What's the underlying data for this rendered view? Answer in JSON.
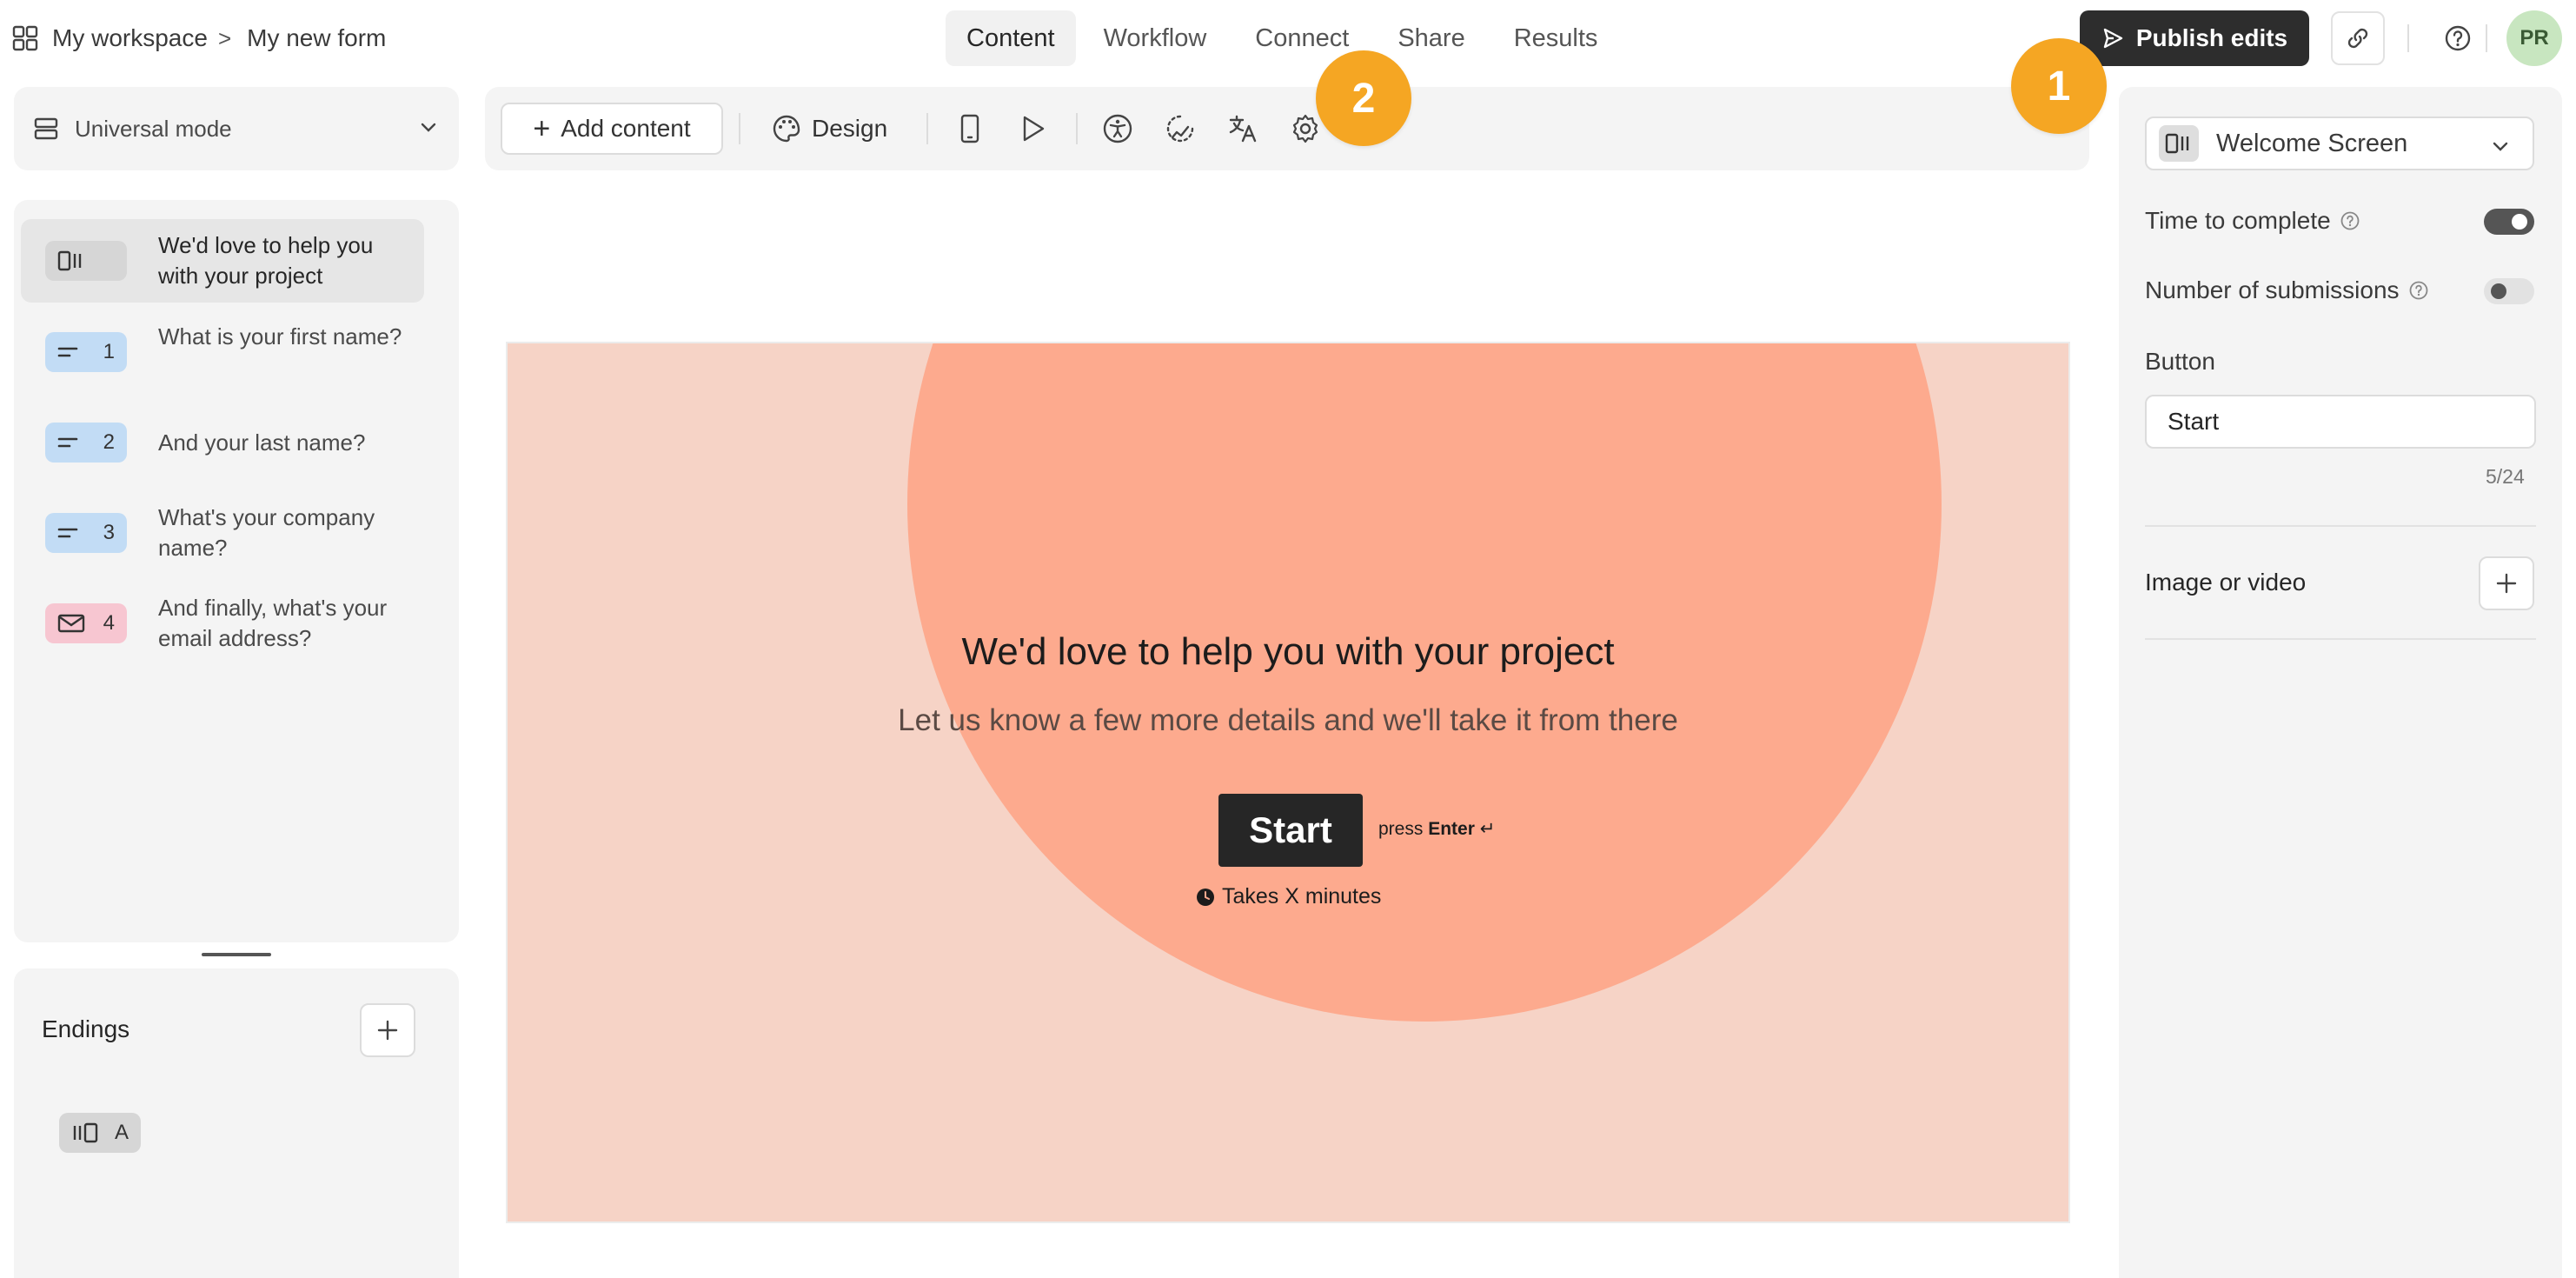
{
  "breadcrumb": {
    "workspace": "My workspace",
    "separator": ">",
    "form_name": "My new form"
  },
  "nav_tabs": [
    {
      "label": "Content",
      "active": true
    },
    {
      "label": "Workflow",
      "active": false
    },
    {
      "label": "Connect",
      "active": false
    },
    {
      "label": "Share",
      "active": false
    },
    {
      "label": "Results",
      "active": false
    }
  ],
  "header": {
    "publish_label": "Publish edits",
    "avatar_initials": "PR"
  },
  "badges": {
    "one": "1",
    "two": "2"
  },
  "sidebar": {
    "mode_label": "Universal mode",
    "questions": [
      {
        "number": "",
        "text": "We'd love to help you with your project",
        "chip_icon": "welcome-screen-icon",
        "active": true
      },
      {
        "number": "1",
        "text": "What is your first name?",
        "chip_icon": "short-text-icon",
        "active": false
      },
      {
        "number": "2",
        "text": "And your last name?",
        "chip_icon": "short-text-icon",
        "active": false
      },
      {
        "number": "3",
        "text": "What's your company name?",
        "chip_icon": "short-text-icon",
        "active": false
      },
      {
        "number": "4",
        "text": "And finally, what's your email address?",
        "chip_icon": "email-icon",
        "active": false
      }
    ],
    "endings_title": "Endings",
    "endings": [
      {
        "letter": "A",
        "chip_icon": "ending-screen-icon"
      }
    ]
  },
  "toolbar": {
    "add_content_label": "Add content",
    "design_label": "Design",
    "icons": [
      "mobile-preview-icon",
      "play-icon",
      "accessibility-icon",
      "loading-icon",
      "translate-icon",
      "settings-icon"
    ]
  },
  "preview": {
    "title": "We'd love to help you with your project",
    "subtitle": "Let us know a few more details and we'll take it from there",
    "start_label": "Start",
    "press_prefix": "press",
    "press_key": "Enter",
    "press_symbol": "↵",
    "time_text": "Takes X minutes",
    "colors": {
      "background": "#f6d3c6",
      "circle": "#fdaa8e",
      "button": "#262626"
    }
  },
  "right_panel": {
    "screen_select": "Welcome Screen",
    "time_to_complete_label": "Time to complete",
    "time_to_complete_on": true,
    "submissions_label": "Number of submissions",
    "submissions_on": false,
    "button_label": "Button",
    "button_value": "Start",
    "char_count": "5/24",
    "image_label": "Image or video"
  },
  "colors": {
    "accent_badge": "#f5a623",
    "publish_button": "#2d2d2d",
    "chip_blue": "#c2dcf5",
    "chip_pink": "#f7c6d1"
  }
}
